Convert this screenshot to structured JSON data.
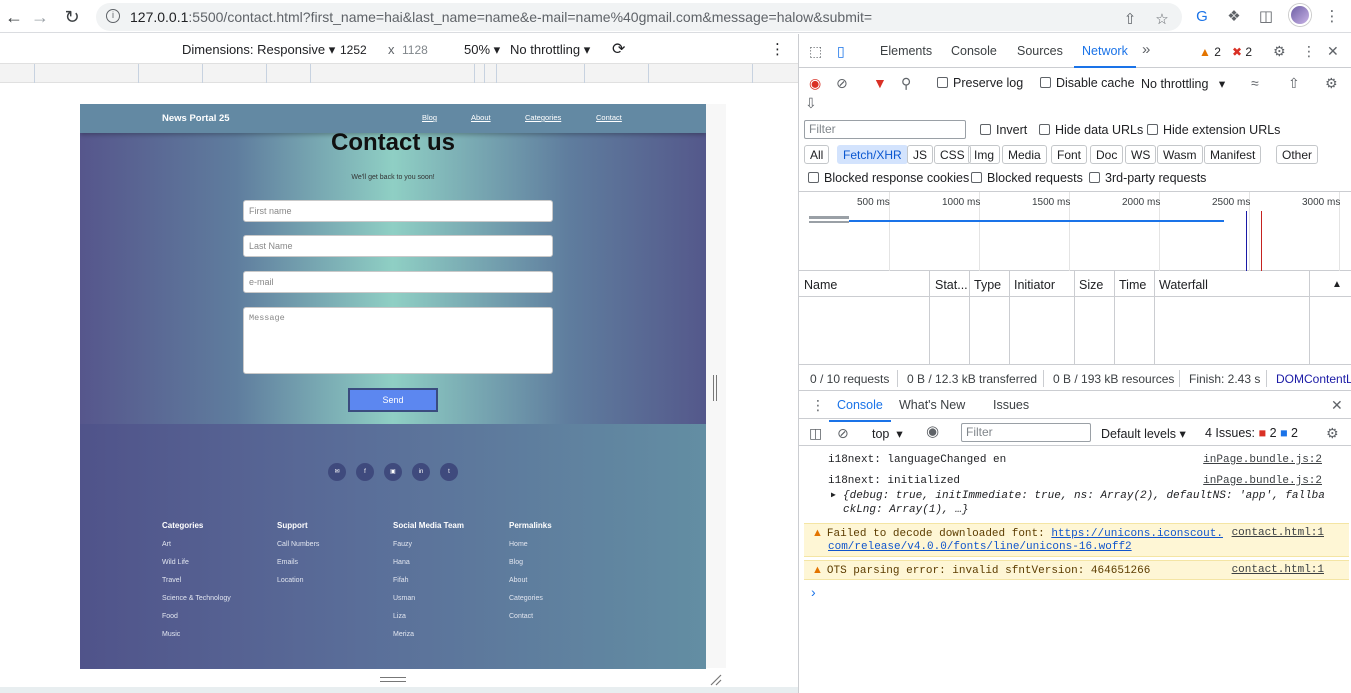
{
  "browser": {
    "url_host": "127.0.0.1",
    "url_rest": ":5500/contact.html?first_name=hai&last_name=name&e-mail=name%40gmail.com&message=halow&submit="
  },
  "device_toolbar": {
    "dimensions_label": "Dimensions: Responsive",
    "width_value": "1252",
    "times": "x",
    "height_value": "1128",
    "zoom": "50%",
    "throttling": "No throttling"
  },
  "site": {
    "brand": "News Portal 25",
    "nav": [
      "Blog",
      "About",
      "Categories",
      "Contact"
    ],
    "title": "Contact us",
    "subtitle": "We'll get back to you soon!",
    "form": {
      "first_name_placeholder": "First name",
      "last_name_placeholder": "Last Name",
      "email_placeholder": "e-mail",
      "message_placeholder": "Message",
      "send_label": "Send"
    },
    "footer": {
      "columns": [
        {
          "title": "Categories",
          "items": [
            "Art",
            "Wild Life",
            "Travel",
            "Science & Technology",
            "Food",
            "Music"
          ]
        },
        {
          "title": "Support",
          "items": [
            "Call Numbers",
            "Emails",
            "Location"
          ]
        },
        {
          "title": "Social Media Team",
          "items": [
            "Fauzy",
            "Hana",
            "Fifah",
            "Usman",
            "Liza",
            "Meriza"
          ]
        },
        {
          "title": "Permalinks",
          "items": [
            "Home",
            "Blog",
            "About",
            "Categories",
            "Contact"
          ]
        }
      ]
    }
  },
  "devtools": {
    "tabs": [
      "Elements",
      "Console",
      "Sources",
      "Network"
    ],
    "active_tab": "Network",
    "warn_count": "2",
    "error_count": "2",
    "network": {
      "preserve_log": "Preserve log",
      "disable_cache": "Disable cache",
      "throttling": "No throttling",
      "filter_placeholder": "Filter",
      "invert": "Invert",
      "hide_data_urls": "Hide data URLs",
      "hide_extension_urls": "Hide extension URLs",
      "chips": [
        "All",
        "Fetch/XHR",
        "JS",
        "CSS",
        "Img",
        "Media",
        "Font",
        "Doc",
        "WS",
        "Wasm",
        "Manifest",
        "Other"
      ],
      "active_chip": "Fetch/XHR",
      "blocked_cookies": "Blocked response cookies",
      "blocked_requests": "Blocked requests",
      "third_party": "3rd-party requests",
      "timeline_labels": [
        "500 ms",
        "1000 ms",
        "1500 ms",
        "2000 ms",
        "2500 ms",
        "3000 ms"
      ],
      "columns": [
        "Name",
        "Stat...",
        "Type",
        "Initiator",
        "Size",
        "Time",
        "Waterfall"
      ],
      "summary": {
        "requests": "0 / 10 requests",
        "transferred": "0 B / 12.3 kB transferred",
        "resources": "0 B / 193 kB resources",
        "finish": "Finish: 2.43 s",
        "dom": "DOMContentL"
      }
    },
    "drawer": {
      "tabs": [
        "Console",
        "What's New",
        "Issues"
      ],
      "context": "top",
      "filter_placeholder": "Filter",
      "levels": "Default levels",
      "issues_label": "4 Issues:",
      "issues_errors": "2",
      "issues_info": "2",
      "messages": [
        {
          "text": "i18next: languageChanged en",
          "source": "inPage.bundle.js:2"
        },
        {
          "text": "i18next: initialized",
          "source": "inPage.bundle.js:2"
        },
        {
          "text": "{debug: true, initImmediate: true, ns: Array(2), defaultNS: 'app', fallba",
          "text2": "ckLng: Array(1), …}"
        },
        {
          "text": "Failed to decode downloaded font: ",
          "link": "https://unicons.iconscout.",
          "link2": "com/release/v4.0.0/fonts/line/unicons-16.woff2",
          "source": "contact.html:1"
        },
        {
          "text": "OTS parsing error: invalid sfntVersion: 464651266",
          "source": "contact.html:1"
        }
      ]
    }
  }
}
